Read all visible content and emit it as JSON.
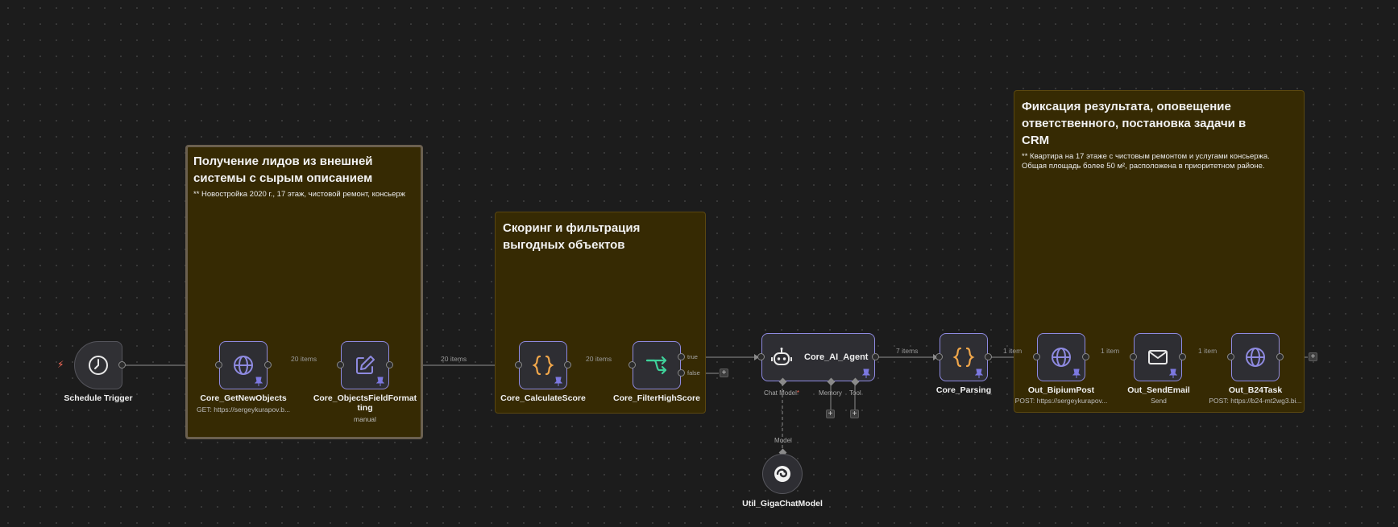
{
  "stickies": {
    "intake": {
      "title": "Получение лидов из внешней системы с сырым описанием",
      "body": "** Новостройка 2020 г., 17 этаж, чистовой ремонт, консьерж"
    },
    "scoring": {
      "title": "Скоринг и фильтрация выгодных объектов",
      "body": ""
    },
    "result": {
      "title": "Фиксация результата, оповещение ответственного, постановка задачи в CRM",
      "body": "** Квартира на 17 этаже с чистовым ремонтом и услугами консьержа. Общая площадь более 50 м², расположена в приоритетном районе."
    }
  },
  "nodes": {
    "schedule_trigger": {
      "label": "Schedule Trigger",
      "icon": "clock-icon"
    },
    "get_new_objects": {
      "label": "Core_GetNewObjects",
      "sub": "GET: https://sergeykurapov.b...",
      "icon": "globe-icon"
    },
    "objects_field_formatting": {
      "label": "Core_ObjectsFieldFormat ting",
      "sub": "manual",
      "icon": "edit-icon"
    },
    "calculate_score": {
      "label": "Core_CalculateScore",
      "icon": "code-braces-icon"
    },
    "filter_high_score": {
      "label": "Core_FilterHighScore",
      "icon": "branch-icon",
      "true_label": "true",
      "false_label": "false"
    },
    "ai_agent": {
      "label": "Core_AI_Agent",
      "icon": "robot-icon",
      "slots": {
        "chat_model": "Chat Model",
        "memory": "Memory",
        "tool": "Tool"
      }
    },
    "giga_chat_model": {
      "label": "Util_GigaChatModel",
      "icon": "gigachat-icon",
      "model_label": "Model"
    },
    "parsing": {
      "label": "Core_Parsing",
      "icon": "code-braces-icon"
    },
    "bipium_post": {
      "label": "Out_BipiumPost",
      "sub": "POST: https://sergeykurapov...",
      "icon": "globe-icon"
    },
    "send_email": {
      "label": "Out_SendEmail",
      "sub": "Send",
      "icon": "envelope-icon"
    },
    "b24_task": {
      "label": "Out_B24Task",
      "sub": "POST: https://b24-mt2wg3.bi...",
      "icon": "globe-icon"
    }
  },
  "edges": {
    "get_to_format": "20 items",
    "format_to_score": "20 items",
    "score_to_filter": "20 items",
    "agent_to_parsing": "7 items",
    "parsing_to_bipium": "1 item",
    "bipium_to_email": "1 item",
    "email_to_b24": "1 item"
  },
  "colors": {
    "canvas": "#1c1c1c",
    "sticky": "#362a03",
    "node_border": "#8e8ae0",
    "trigger_bolt": "#ff6d5a",
    "globe_icon": "#8e8ae0",
    "code_icon": "#f0a64a",
    "branch_icon": "#3ed19a",
    "pin": "#7c78e0",
    "edge": "#7a7a7a"
  }
}
